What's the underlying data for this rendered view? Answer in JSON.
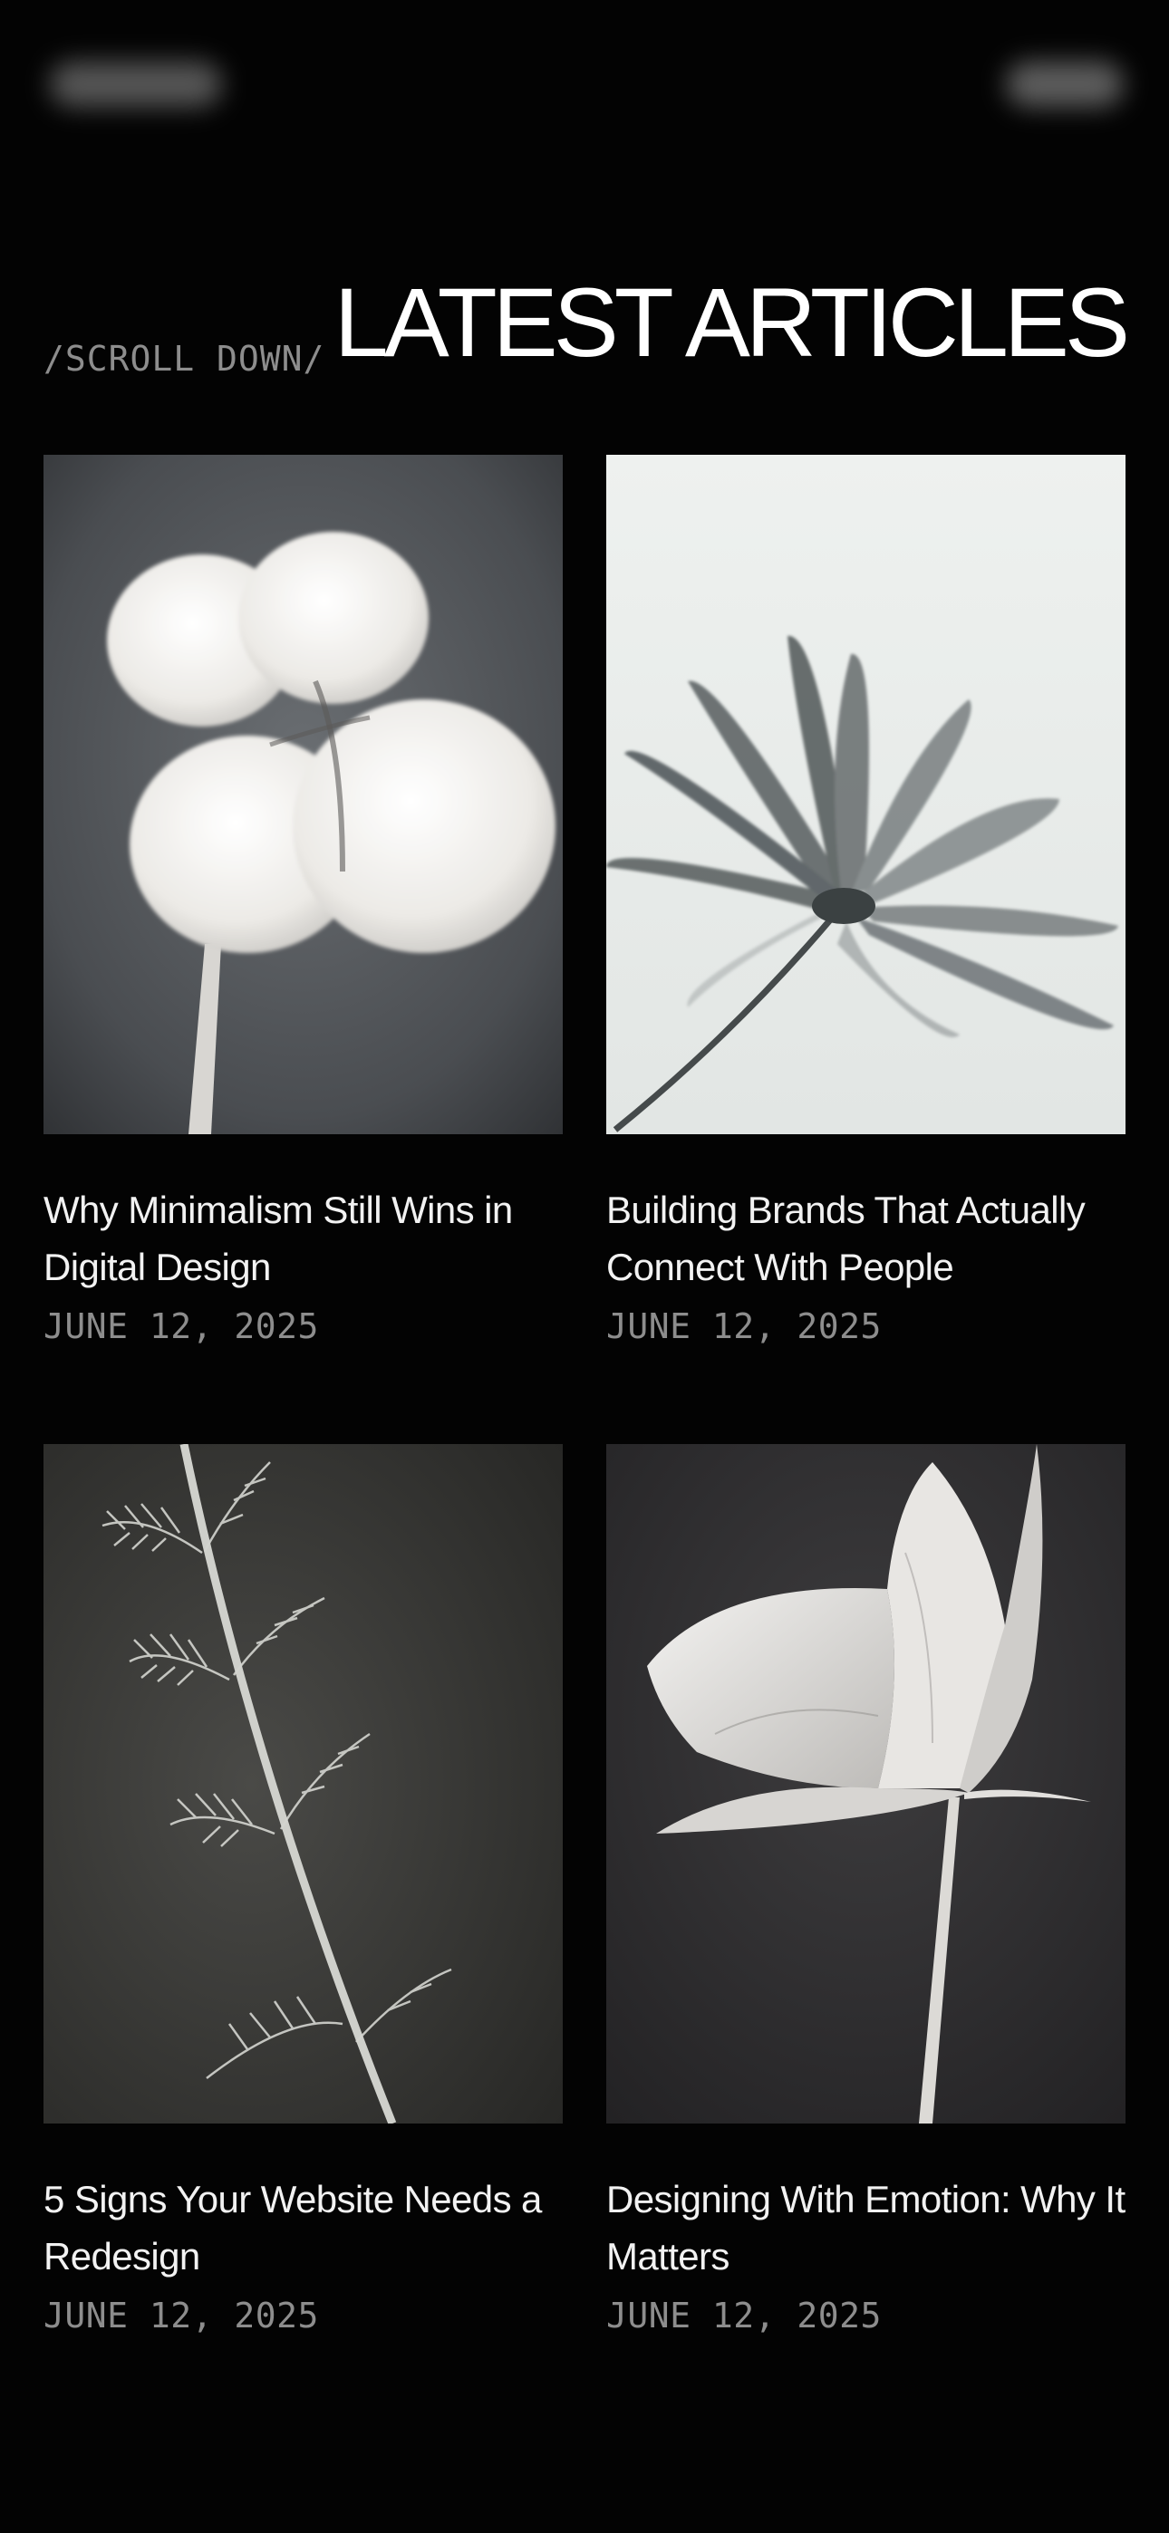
{
  "header": {
    "scroll_hint": "/SCROLL DOWN/",
    "title": "LATEST ARTICLES"
  },
  "articles": [
    {
      "title": "Why Minimalism Still Wins in Digital Design",
      "date": "JUNE 12, 2025",
      "image": "cotton-boll-photo"
    },
    {
      "title": "Building Brands That Actually Connect With People",
      "date": "JUNE 12, 2025",
      "image": "daisy-silhouette-photo"
    },
    {
      "title": "5 Signs Your Website Needs a Redesign",
      "date": "JUNE 12, 2025",
      "image": "grass-stem-photo"
    },
    {
      "title": "Designing With Emotion: Why It Matters",
      "date": "JUNE 12, 2025",
      "image": "tulip-photo"
    }
  ],
  "colors": {
    "background": "#030303",
    "title_text": "#ffffff",
    "muted_text": "#8d8d8d"
  }
}
